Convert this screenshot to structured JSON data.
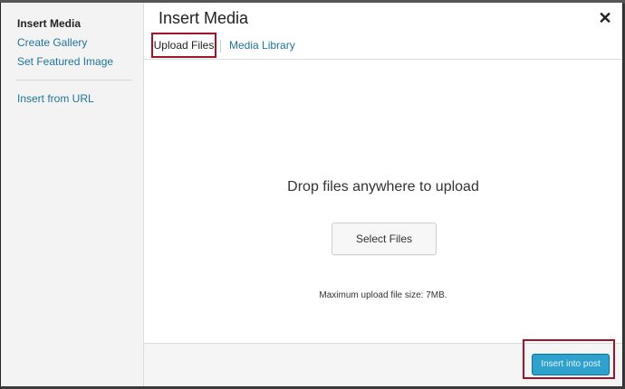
{
  "sidebar": {
    "items": [
      {
        "label": "Insert Media",
        "active": true
      },
      {
        "label": "Create Gallery",
        "active": false
      },
      {
        "label": "Set Featured Image",
        "active": false
      },
      {
        "label": "Insert from URL",
        "active": false
      }
    ]
  },
  "frame": {
    "title": "Insert Media",
    "close_icon": "close-icon",
    "close_glyph": "✕"
  },
  "tabs": [
    {
      "label": "Upload Files",
      "active": true
    },
    {
      "label": "Media Library",
      "active": false
    }
  ],
  "uploader": {
    "drop_text": "Drop files anywhere to upload",
    "select_button_label": "Select Files",
    "max_size_text": "Maximum upload file size: 7MB."
  },
  "toolbar": {
    "insert_button_label": "Insert into post"
  },
  "colors": {
    "link": "#21759b",
    "primary_button": "#2ea2cc",
    "highlight_border": "#a1132b"
  }
}
